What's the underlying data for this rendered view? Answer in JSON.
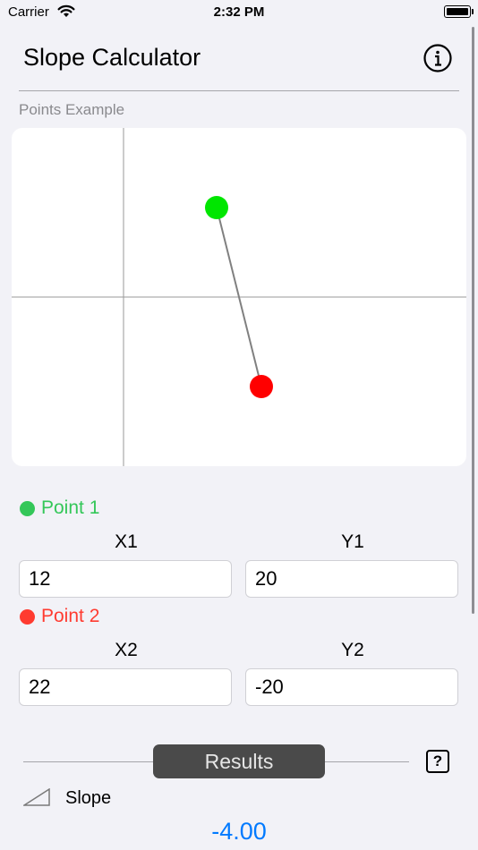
{
  "status_bar": {
    "carrier": "Carrier",
    "time": "2:32 PM"
  },
  "header": {
    "title": "Slope Calculator",
    "info_icon": "info-circle-icon"
  },
  "section_label": "Points Example",
  "graph": {
    "point1_color": "#00e600",
    "point2_color": "#ff0000",
    "line_color": "#808080",
    "axis_color": "#9a9a9a"
  },
  "point1": {
    "label": "Point 1",
    "x_header": "X1",
    "y_header": "Y1",
    "x_value": "12",
    "y_value": "20",
    "color": "#34c759"
  },
  "point2": {
    "label": "Point 2",
    "x_header": "X2",
    "y_header": "Y2",
    "x_value": "22",
    "y_value": "-20",
    "color": "#ff3b30"
  },
  "results": {
    "button_label": "Results",
    "help_label": "?",
    "slope_label": "Slope",
    "slope_value": "-4.00",
    "value_color": "#007aff"
  }
}
